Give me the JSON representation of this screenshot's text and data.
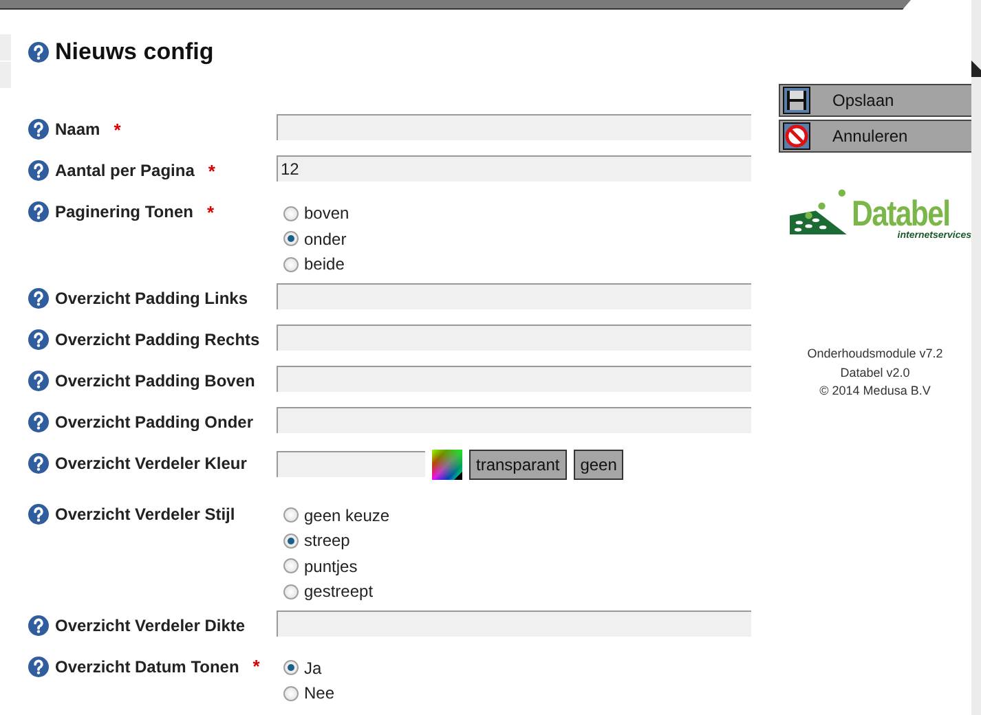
{
  "title": "Nieuws config",
  "fields": [
    {
      "kind": "text",
      "label": "Naam",
      "marker": "*"
    },
    {
      "kind": "text",
      "label": "Aantal per Pagina",
      "marker": "*",
      "value": "12"
    },
    {
      "kind": "radio",
      "label": "Paginering Tonen",
      "marker": "*",
      "options": [
        {
          "label": "boven",
          "selected": false
        },
        {
          "label": "onder",
          "selected": true
        },
        {
          "label": "beide",
          "selected": false
        }
      ]
    },
    {
      "kind": "text",
      "label": "Overzicht Padding Links"
    },
    {
      "kind": "text",
      "label": "Overzicht Padding Rechts"
    },
    {
      "kind": "text",
      "label": "Overzicht Padding Boven"
    },
    {
      "kind": "text",
      "label": "Overzicht Padding Onder"
    },
    {
      "kind": "color",
      "label": "Overzicht Verdeler Kleur",
      "buttons": [
        "transparant",
        "geen"
      ]
    },
    {
      "kind": "radio",
      "label": "Overzicht Verdeler Stijl",
      "options": [
        {
          "label": "geen keuze",
          "selected": false
        },
        {
          "label": "streep",
          "selected": true
        },
        {
          "label": "puntjes",
          "selected": false
        },
        {
          "label": "gestreept",
          "selected": false
        }
      ]
    },
    {
      "kind": "text",
      "label": "Overzicht Verdeler Dikte"
    },
    {
      "kind": "radio",
      "label": "Overzicht Datum Tonen",
      "marker": "*",
      "options": [
        {
          "label": "Ja",
          "selected": true
        },
        {
          "label": "Nee",
          "selected": false
        }
      ]
    }
  ],
  "actions": [
    {
      "kind": "save",
      "label": "Opslaan"
    },
    {
      "kind": "cancel",
      "label": "Annuleren"
    }
  ],
  "logo": {
    "name": "Databel",
    "tagline": "internetservices"
  },
  "footer": [
    "Onderhoudsmodule v7.2",
    "Databel v2.0",
    "© 2014 Medusa B.V"
  ]
}
